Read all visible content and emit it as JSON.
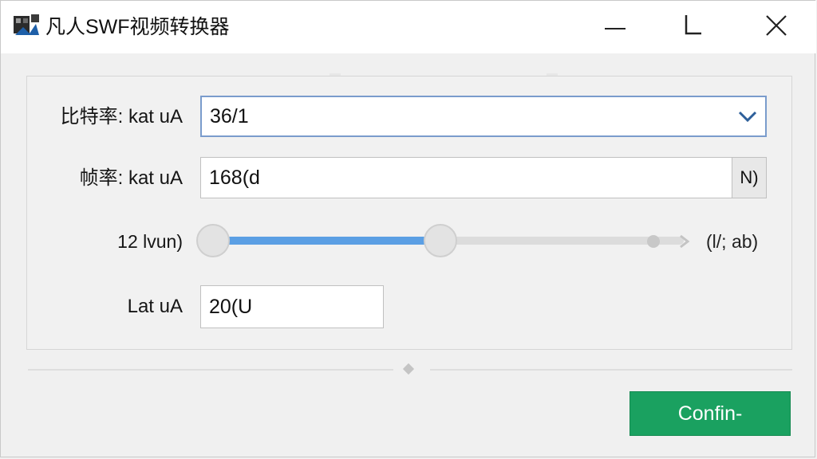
{
  "window": {
    "title": "凡人SWF视频转换器",
    "controls": {
      "minimize_icon": "minimize-icon",
      "maximize_icon": "maximize-icon",
      "close_icon": "close-icon"
    }
  },
  "form": {
    "bitrate": {
      "label": "比特率: kat uA",
      "value": "36/1",
      "dropdown_icon": "chevron-down-icon"
    },
    "framerate": {
      "label": "帧率: kat uA",
      "value": "168(d",
      "button_label": "N)"
    },
    "slider": {
      "label": "12 lvun)",
      "value_text": "(l/; ab)",
      "level_fraction": 0.49
    },
    "small_field": {
      "label": "Lat uA",
      "value": "20(U"
    }
  },
  "actions": {
    "confirm_label": "Confin-"
  },
  "colors": {
    "accent_blue": "#5b9fe4",
    "confirm_green": "#1aa160",
    "focus_border": "#7a9ccc"
  }
}
